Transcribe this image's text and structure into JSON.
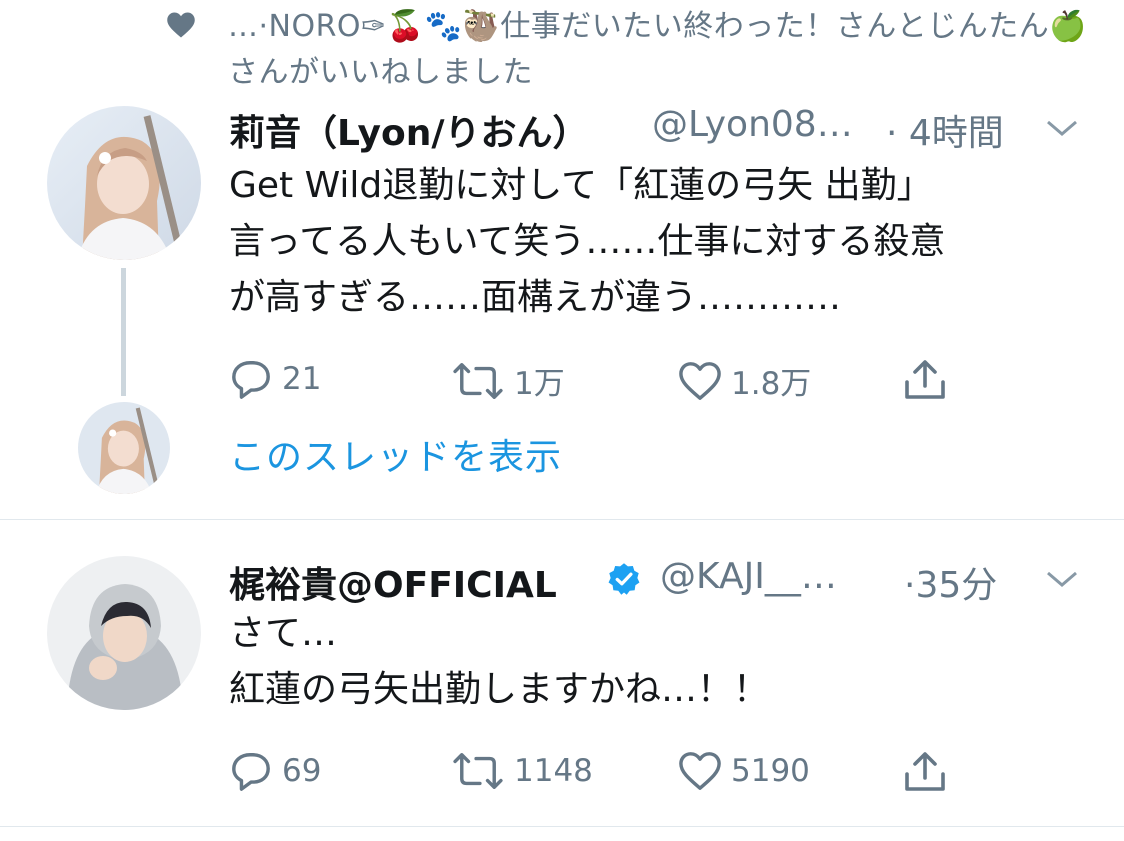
{
  "social_context": {
    "text": "…·NORO✑🍒🐾🦥仕事だいたい終わった！さんとじんたん🍏さんがいいねしました",
    "icon": "heart-icon"
  },
  "tweets": [
    {
      "name": "莉音（Lyon/りおん）",
      "handle": "@Lyon08…",
      "time": "· 4時間",
      "body": "Get Wild退勤に対して「紅蓮の弓矢 出勤」\n言ってる人もいて笑う……仕事に対する殺意\nが高すぎる……面構えが違う…………",
      "replies": "21",
      "retweets": "1万",
      "likes": "1.8万",
      "show_thread": "このスレッドを表示"
    },
    {
      "name": "梶裕貴@OFFICIAL",
      "handle": "@KAJI__…",
      "time": "·35分",
      "body": "さて…\n紅蓮の弓矢出勤しますかね…！！",
      "replies": "69",
      "retweets": "1148",
      "likes": "5190",
      "verified": true
    }
  ],
  "colors": {
    "text": "#14171a",
    "secondary": "#657786",
    "link": "#1b95e0",
    "verified": "#1da1f2",
    "divider": "#e1e8ed"
  }
}
